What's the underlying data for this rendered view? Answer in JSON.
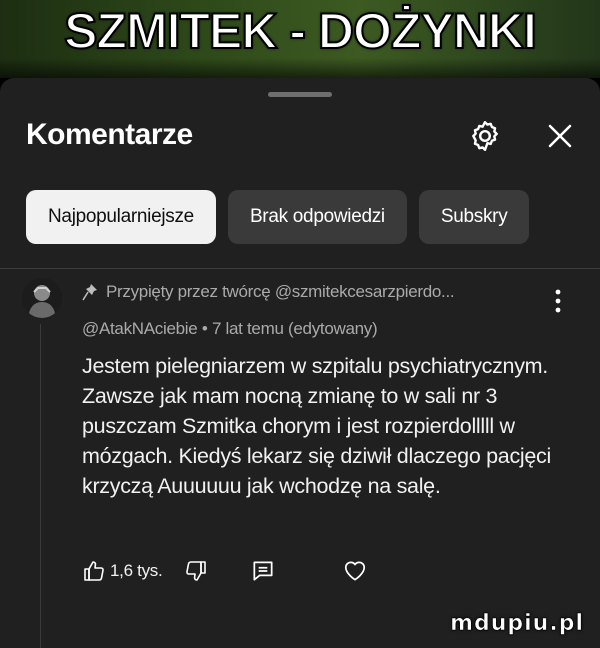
{
  "video": {
    "overlay_text": "SZMITEK - DOŻYNKI"
  },
  "panel": {
    "title": "Komentarze",
    "settings_icon": "gear-icon",
    "close_icon": "close-icon"
  },
  "filters": [
    {
      "label": "Najpopularniejsze",
      "selected": true
    },
    {
      "label": "Brak odpowiedzi",
      "selected": false
    },
    {
      "label": "Subskry",
      "selected": false
    }
  ],
  "comment": {
    "pinned_label": "Przypięty przez twórcę @szmitekcesarzpierdo...",
    "author": "@AtakNAciebie",
    "separator": "•",
    "time": "7 lat temu (edytowany)",
    "text": "Jestem pielegniarzem w szpitalu psychiatrycznym. Zawsze jak mam nocną zmianę to w sali nr 3 puszczam Szmitka chorym i jest rozpierdolllll w mózgach. Kiedyś lekarz się dziwił dlaczego pacjęci krzyczą Auuuuuu jak wchodzę na salę.",
    "like_count": "1,6 tys.",
    "icons": [
      "thumbs-up-icon",
      "thumbs-down-icon",
      "reply-icon",
      "heart-icon",
      "pin-icon",
      "more-vert-icon"
    ]
  },
  "watermark": "mdupiu.pl",
  "colors": {
    "panel_bg": "#202020",
    "chip_active_bg": "#f1f1f1",
    "chip_bg": "#3a3a3a",
    "secondary_text": "#aaaaaa"
  }
}
